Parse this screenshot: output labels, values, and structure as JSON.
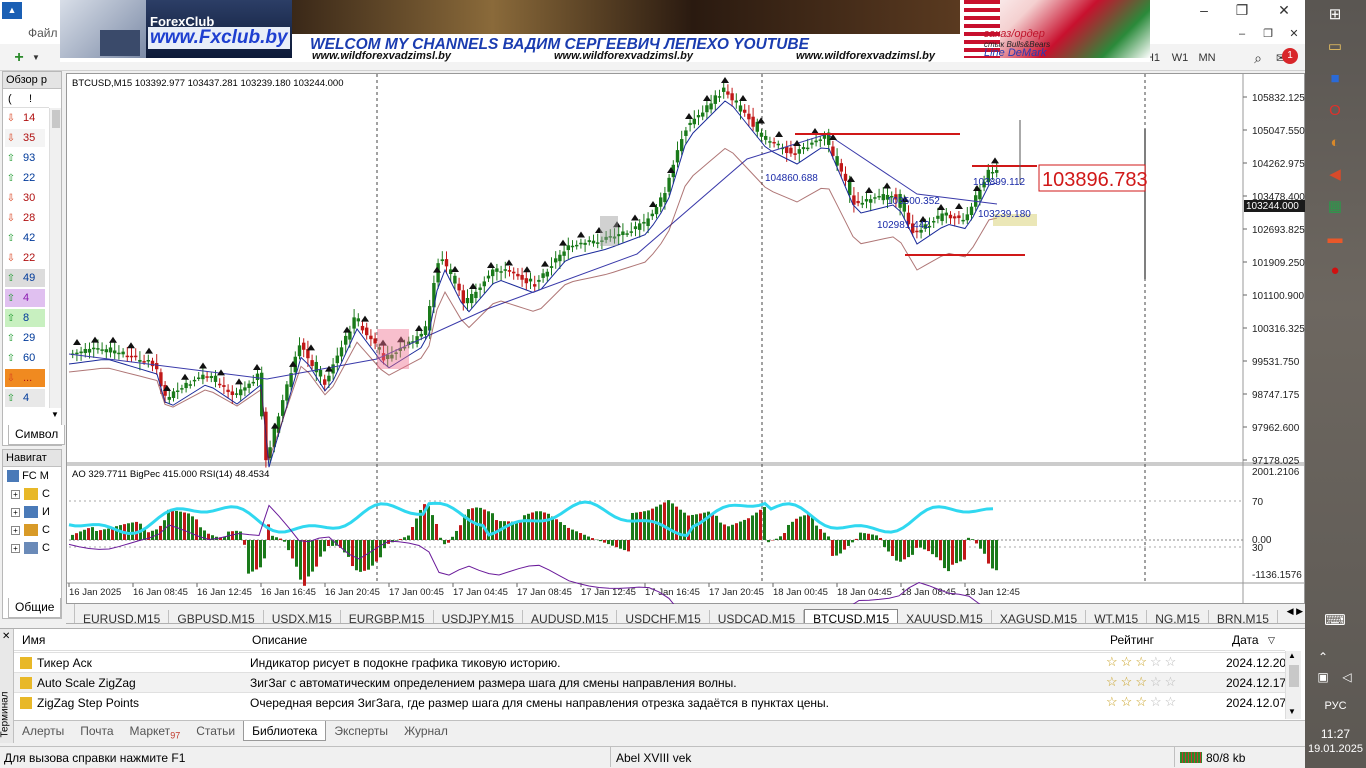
{
  "window": {
    "menu_file": "Файл",
    "controls": [
      "–",
      "❐",
      "✕"
    ],
    "inner_controls": [
      "–",
      "❐",
      "✕"
    ],
    "timeframes": [
      "H1",
      "W1",
      "MN"
    ],
    "notification_count": "1"
  },
  "banner": {
    "logo_text": "ForexClub",
    "site_big": "www.Fxclub.by",
    "headline": "WELCOM MY CHANNELS ВАДИМ СЕРГЕЕВИЧ ЛЕПЕХО YOUTUBE",
    "urls": [
      "www.wildforexvadzimsl.by",
      "www.wildforexvadzimsl.by",
      "www.wildforexvadzimsl.by"
    ],
    "right_lines": [
      "заказ/ордер",
      "стык Bulls&Bears",
      "Line DeMark"
    ]
  },
  "market_watch": {
    "title": "Обзор р",
    "header_cells": [
      "(",
      "!"
    ],
    "rows": [
      {
        "value": "14",
        "dir": "down"
      },
      {
        "value": "35",
        "dir": "down"
      },
      {
        "value": "93",
        "dir": "up"
      },
      {
        "value": "22",
        "dir": "up"
      },
      {
        "value": "30",
        "dir": "down"
      },
      {
        "value": "28",
        "dir": "down"
      },
      {
        "value": "42",
        "dir": "up"
      },
      {
        "value": "22",
        "dir": "down"
      },
      {
        "value": "49",
        "dir": "up"
      },
      {
        "value": "4",
        "dir": "up"
      },
      {
        "value": "8",
        "dir": "up"
      },
      {
        "value": "29",
        "dir": "up"
      },
      {
        "value": "60",
        "dir": "up"
      },
      {
        "value": "...",
        "dir": "down"
      },
      {
        "value": "4",
        "dir": "up"
      }
    ],
    "tab": "Символ"
  },
  "navigator": {
    "title": "Навигат",
    "root": "FC M",
    "items": [
      "С",
      "И",
      "С",
      "С"
    ],
    "tab": "Общие"
  },
  "chart": {
    "symbol_line": "BTCUSD,M15  103392.977 103437.281 103239.180 103244.000",
    "oscillator_line": "AO 329.7711  BigPec 415.000  RSI(14) 48.4534",
    "big_price": "103896.783",
    "current_price": "103244.000",
    "price_labels": [
      "103899.112",
      "104860.688",
      "103239.180",
      "102981.442",
      "103500.352"
    ],
    "y_ticks": [
      "105832.125",
      "105047.550",
      "104262.975",
      "103478.400",
      "102693.825",
      "101909.250",
      "101100.900",
      "100316.325",
      "99531.750",
      "98747.175",
      "97962.600",
      "97178.025"
    ],
    "sub_ticks": [
      "2001.2106",
      "70",
      "0.00",
      "30",
      "-1136.1576"
    ],
    "x_ticks": [
      "16 Jan 2025",
      "16 Jan 08:45",
      "16 Jan 12:45",
      "16 Jan 16:45",
      "16 Jan 20:45",
      "17 Jan 00:45",
      "17 Jan 04:45",
      "17 Jan 08:45",
      "17 Jan 12:45",
      "17 Jan 16:45",
      "17 Jan 20:45",
      "18 Jan 00:45",
      "18 Jan 04:45",
      "18 Jan 08:45",
      "18 Jan 12:45"
    ]
  },
  "chart_tabs": [
    "EURUSD,M15",
    "GBPUSD,M15",
    "USDX,M15",
    "EURGBP,M15",
    "USDJPY,M15",
    "AUDUSD,M15",
    "USDCHF,M15",
    "USDCAD,M15",
    "BTCUSD,M15",
    "XAUUSD,M15",
    "XAGUSD,M15",
    "WT,M15",
    "NG,M15",
    "BRN,M15"
  ],
  "active_chart_tab": "BTCUSD,M15",
  "terminal": {
    "side_label": "Терминал",
    "columns": {
      "name": "Имя",
      "description": "Описание",
      "rating": "Рейтинг",
      "date": "Дата"
    },
    "rows": [
      {
        "name": "Тикер Аск",
        "description": "Индикатор рисует в подокне графика тиковую историю.",
        "stars": 3,
        "date": "2024.12.20"
      },
      {
        "name": "Auto Scale ZigZag",
        "description": "ЗигЗаг с автоматическим определением размера шага для смены направления волны.",
        "stars": 3,
        "date": "2024.12.17"
      },
      {
        "name": "ZigZag Step Points",
        "description": "Очередная версия ЗигЗага, где размер шага для смены направления отрезка задаётся в пунктах цены.",
        "stars": 3,
        "date": "2024.12.07"
      }
    ],
    "tabs": [
      "Алерты",
      "Почта",
      "Маркет",
      "Статьи",
      "Библиотека",
      "Эксперты",
      "Журнал"
    ],
    "market_badge": "97",
    "active_tab": "Библиотека"
  },
  "status": {
    "help": "Для вызова справки нажмите F1",
    "profile": "Abel XVIII vek",
    "traffic": "80/8 kb"
  },
  "taskbar": {
    "lang": "РУС",
    "time": "11:27",
    "date": "19.01.2025"
  }
}
